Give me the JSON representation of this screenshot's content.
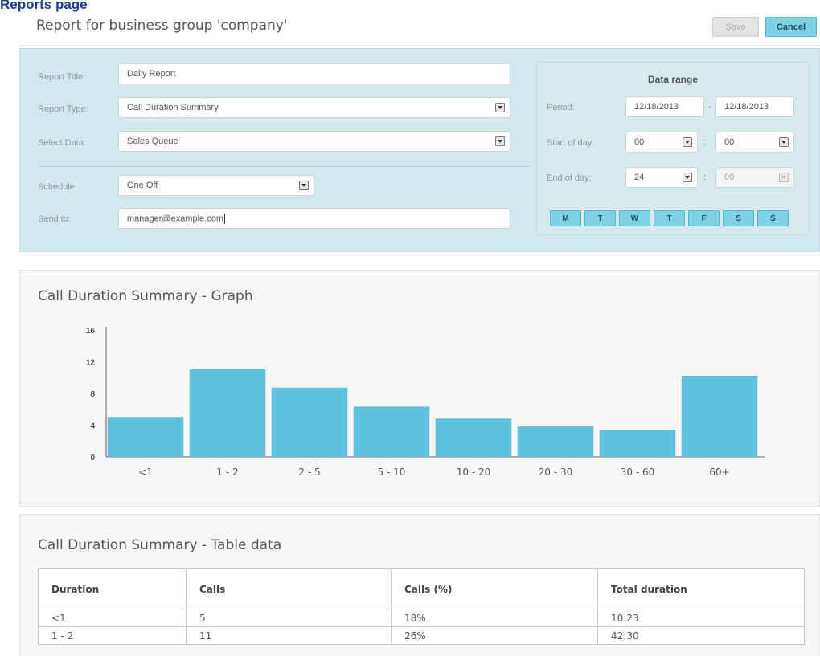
{
  "page": {
    "heading": "Reports page",
    "report_header": "Report for business group 'company'",
    "buttons": {
      "save": "Save",
      "cancel": "Cancel"
    }
  },
  "form": {
    "report_title": {
      "label": "Report Title:",
      "value": "Daily Report"
    },
    "report_type": {
      "label": "Report Type:",
      "value": "Call Duration Summary"
    },
    "select_data": {
      "label": "Select Data:",
      "value": "Sales Queue"
    },
    "schedule": {
      "label": "Schedule:",
      "value": "One Off"
    },
    "send_to": {
      "label": "Send to:",
      "value": "manager@example.com"
    }
  },
  "data_range": {
    "title": "Data range",
    "period": {
      "label": "Period:",
      "from": "12/18/2013",
      "separator": "-",
      "to": "12/18/2013"
    },
    "start_of_day": {
      "label": "Start of day:",
      "hour": "00",
      "separator": ":",
      "minute": "00"
    },
    "end_of_day": {
      "label": "End of day:",
      "hour": "24",
      "separator": ":",
      "minute": "00"
    },
    "days": [
      "M",
      "T",
      "W",
      "T",
      "F",
      "S",
      "S"
    ]
  },
  "graph": {
    "title": "Call Duration Summary - Graph"
  },
  "chart_data": {
    "type": "bar",
    "title": "",
    "xlabel": "",
    "ylabel": "",
    "categories": [
      "<1",
      "1 - 2",
      "2 - 5",
      "5 - 10",
      "10 - 20",
      "20 - 30",
      "30 - 60",
      "60+"
    ],
    "values": [
      5,
      11,
      8.7,
      6.3,
      4.8,
      3.8,
      3.3,
      10.2
    ],
    "ylim": [
      0,
      16
    ],
    "yticks": [
      "0",
      "4",
      "8",
      "12",
      "16"
    ],
    "grid": false,
    "bar_color": "#5dc3dd"
  },
  "table": {
    "title": "Call Duration Summary - Table data",
    "headers": [
      "Duration",
      "Calls",
      "Calls (%)",
      "Total duration"
    ],
    "rows": [
      [
        "<1",
        "5",
        "18%",
        "10:23"
      ],
      [
        "1 - 2",
        "11",
        "26%",
        "42:30"
      ]
    ]
  },
  "colors": {
    "accent": "#7fd2e4",
    "panel": "#d2e8ec",
    "heading": "#1a3c8c"
  }
}
